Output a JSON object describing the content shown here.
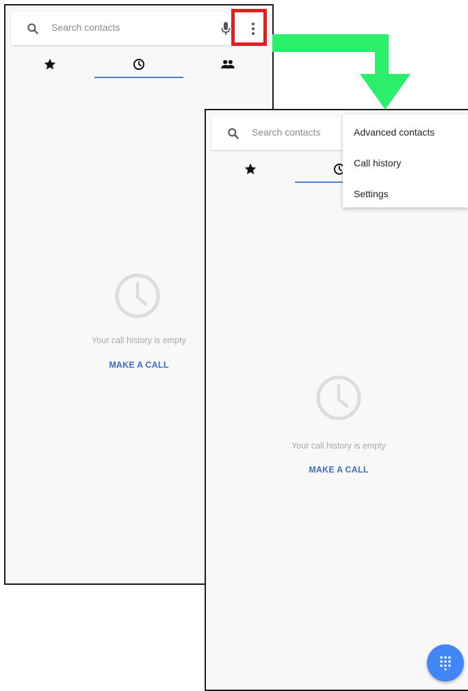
{
  "screen_before": {
    "search": {
      "placeholder": "Search contacts"
    },
    "tabs": [
      {
        "icon": "star-icon",
        "label": "Favorites"
      },
      {
        "icon": "clock-icon",
        "label": "Recents",
        "selected": true
      },
      {
        "icon": "people-icon",
        "label": "Contacts"
      }
    ],
    "empty_state": {
      "message": "Your call history is empty",
      "action_label": "MAKE A CALL"
    }
  },
  "screen_after": {
    "search": {
      "placeholder": "Search contacts"
    },
    "overflow_menu": {
      "items": [
        {
          "label": "Advanced contacts"
        },
        {
          "label": "Call history"
        },
        {
          "label": "Settings"
        }
      ]
    },
    "empty_state": {
      "message": "Your call history is empty",
      "action_label": "MAKE A CALL"
    },
    "fab": {
      "icon": "dialpad-icon"
    }
  },
  "colors": {
    "accent": "#3f6fc4",
    "tab_indicator": "#4a7fd0",
    "fab": "#4285f4",
    "highlight": "#e41e1e",
    "arrow": "#2bef6b"
  }
}
